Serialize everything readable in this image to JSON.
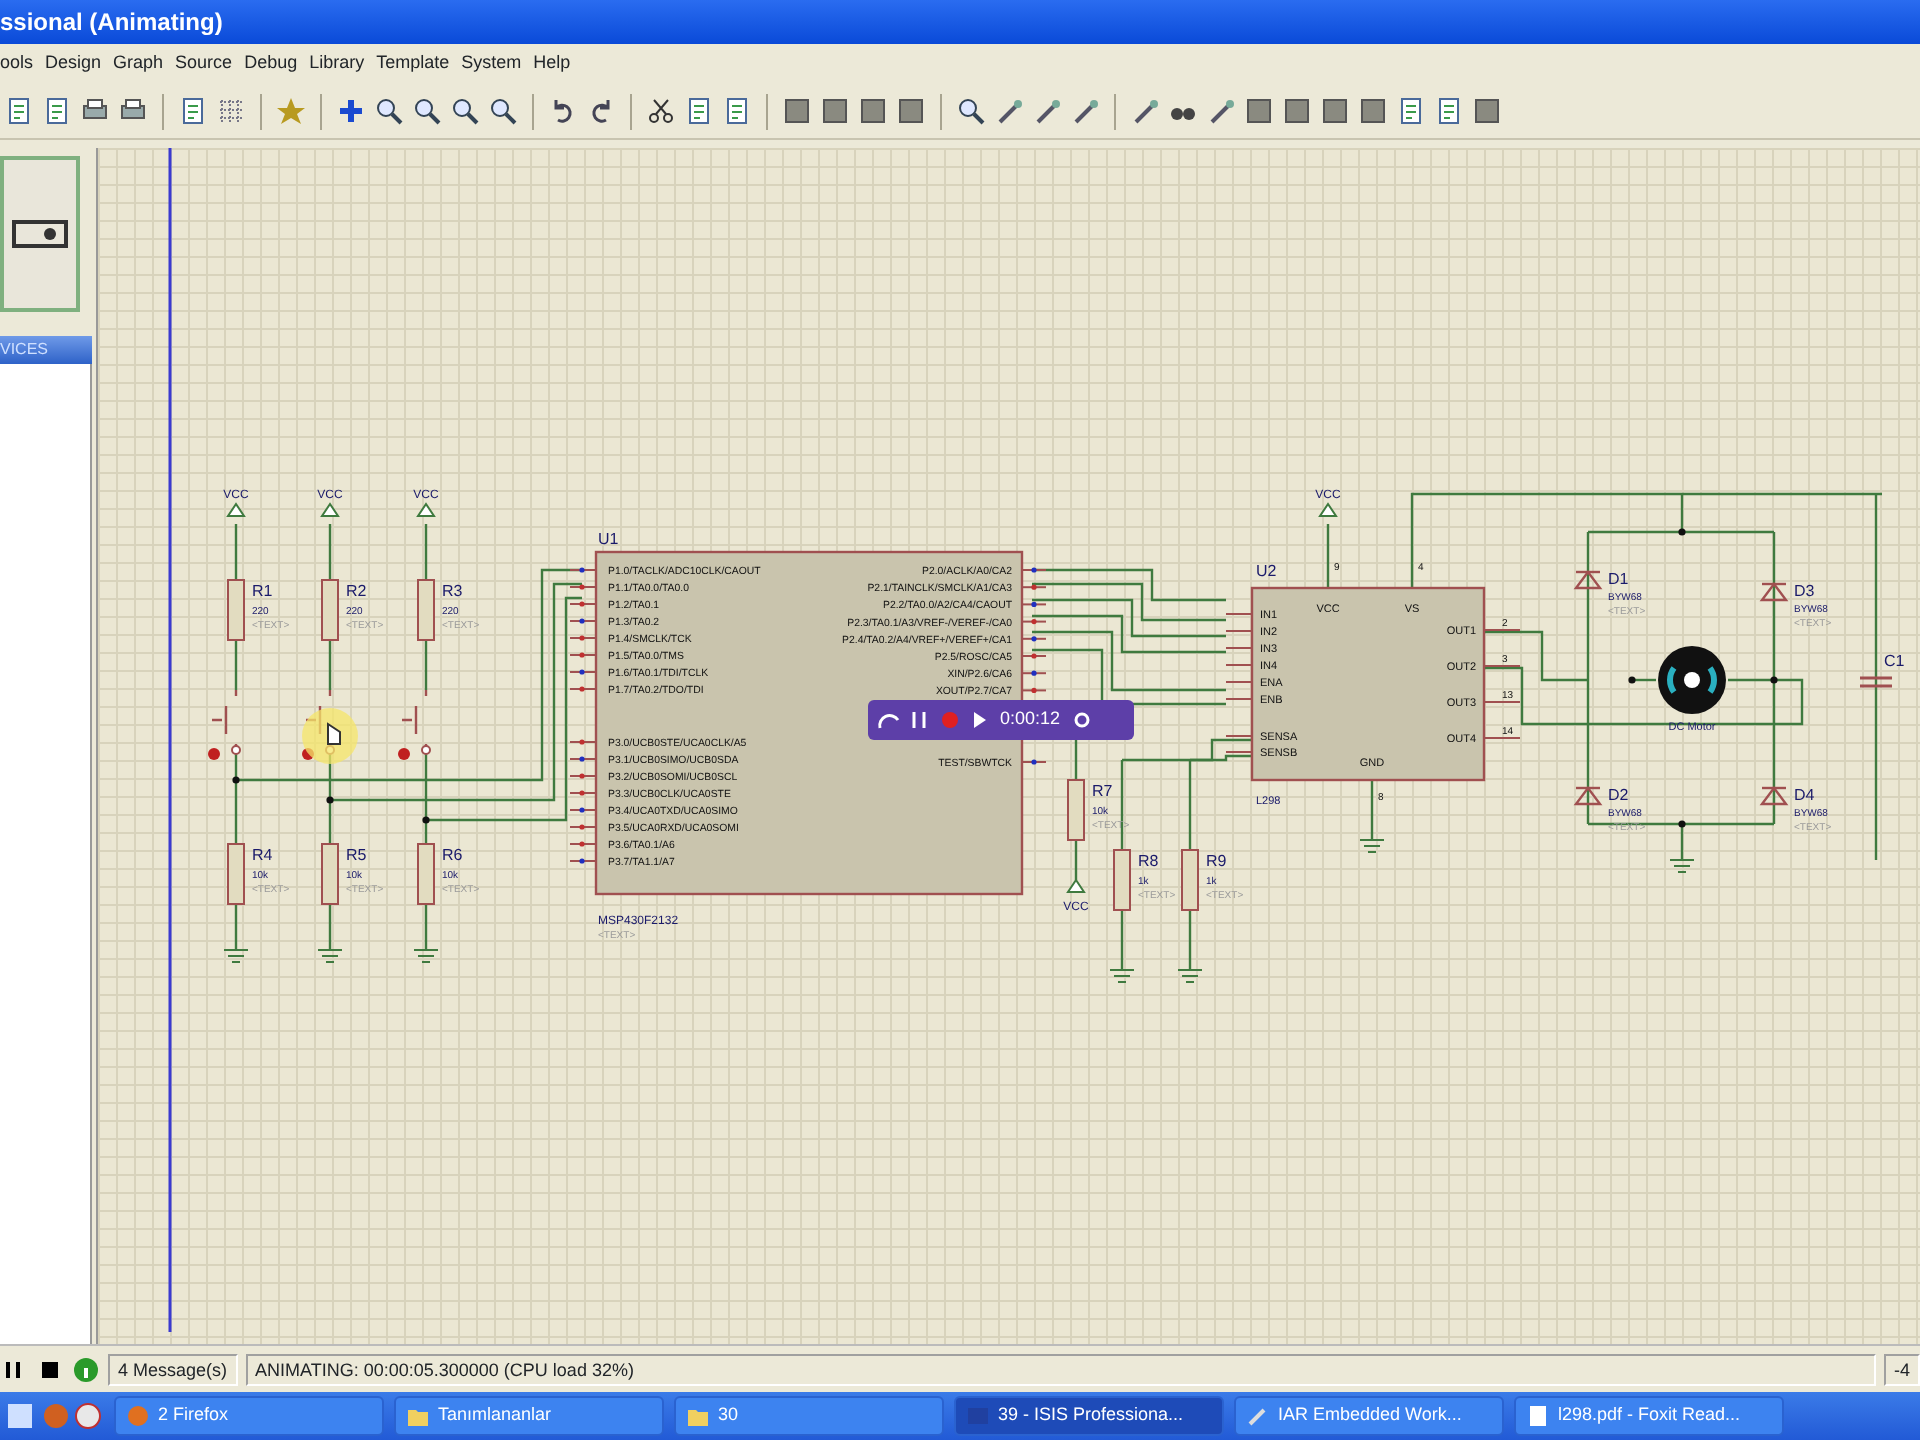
{
  "window": {
    "title": "ssional (Animating)"
  },
  "menu": [
    "ools",
    "Design",
    "Graph",
    "Source",
    "Debug",
    "Library",
    "Template",
    "System",
    "Help"
  ],
  "sidebar": {
    "header": "VICES"
  },
  "schematic": {
    "power": [
      {
        "kind": "vcc",
        "label": "VCC"
      },
      {
        "kind": "vcc",
        "label": "VCC"
      },
      {
        "kind": "vcc",
        "label": "VCC"
      },
      {
        "kind": "vcc",
        "label": "VCC"
      },
      {
        "kind": "vcc",
        "label": "VCC"
      }
    ],
    "resistors": [
      {
        "ref": "R1",
        "value": "220",
        "tag": "<TEXT>"
      },
      {
        "ref": "R2",
        "value": "220",
        "tag": "<TEXT>"
      },
      {
        "ref": "R3",
        "value": "220",
        "tag": "<TEXT>"
      },
      {
        "ref": "R4",
        "value": "10k",
        "tag": "<TEXT>"
      },
      {
        "ref": "R5",
        "value": "10k",
        "tag": "<TEXT>"
      },
      {
        "ref": "R6",
        "value": "10k",
        "tag": "<TEXT>"
      },
      {
        "ref": "R7",
        "value": "10k",
        "tag": "<TEXT>"
      },
      {
        "ref": "R8",
        "value": "1k",
        "tag": "<TEXT>"
      },
      {
        "ref": "R9",
        "value": "1k",
        "tag": "<TEXT>"
      }
    ],
    "u1": {
      "ref": "U1",
      "part": "MSP430F2132",
      "tag": "<TEXT>",
      "left_pins": [
        "P1.0/TACLK/ADC10CLK/CAOUT",
        "P1.1/TA0.0/TA0.0",
        "P1.2/TA0.1",
        "P1.3/TA0.2",
        "P1.4/SMCLK/TCK",
        "P1.5/TA0.0/TMS",
        "P1.6/TA0.1/TDI/TCLK",
        "P1.7/TA0.2/TDO/TDI",
        "P3.0/UCB0STE/UCA0CLK/A5",
        "P3.1/UCB0SIMO/UCB0SDA",
        "P3.2/UCB0SOMI/UCB0SCL",
        "P3.3/UCB0CLK/UCA0STE",
        "P3.4/UCA0TXD/UCA0SIMO",
        "P3.5/UCA0RXD/UCA0SOMI",
        "P3.6/TA0.1/A6",
        "P3.7/TA1.1/A7"
      ],
      "right_pins": [
        "P2.0/ACLK/A0/CA2",
        "P2.1/TAINCLK/SMCLK/A1/CA3",
        "P2.2/TA0.0/A2/CA4/CAOUT",
        "P2.3/TA0.1/A3/VREF-/VEREF-/CA0",
        "P2.4/TA0.2/A4/VREF+/VEREF+/CA1",
        "P2.5/ROSC/CA5",
        "XIN/P2.6/CA6",
        "XOUT/P2.7/CA7",
        "TEST/SBWTCK"
      ]
    },
    "u2": {
      "ref": "U2",
      "part": "L298",
      "left_pins": [
        "IN1",
        "IN2",
        "IN3",
        "IN4",
        "ENA",
        "ENB",
        "SENSA",
        "SENSB"
      ],
      "top_pins": [
        "VCC",
        "VS"
      ],
      "top_numbers": [
        "9",
        "4"
      ],
      "right_pins": [
        "OUT1",
        "OUT2",
        "OUT3",
        "OUT4"
      ],
      "right_numbers": [
        "2",
        "3",
        "13",
        "14"
      ],
      "bottom_pin": "GND",
      "bottom_number": "8"
    },
    "diodes": [
      {
        "ref": "D1",
        "part": "BYW68",
        "tag": "<TEXT>"
      },
      {
        "ref": "D3",
        "part": "BYW68",
        "tag": "<TEXT>"
      },
      {
        "ref": "D2",
        "part": "BYW68",
        "tag": "<TEXT>"
      },
      {
        "ref": "D4",
        "part": "BYW68",
        "tag": "<TEXT>"
      }
    ],
    "motor": {
      "label": "DC Motor"
    },
    "capacitor": {
      "ref": "C1"
    }
  },
  "recorder": {
    "time": "0:00:12"
  },
  "status": {
    "messages": "4 Message(s)",
    "animation": "ANIMATING: 00:00:05.300000 (CPU load 32%)",
    "edge": "-4"
  },
  "taskbar": [
    {
      "label": "2 Firefox",
      "selected": false
    },
    {
      "label": "Tanımlananlar",
      "selected": false
    },
    {
      "label": "30",
      "selected": false
    },
    {
      "label": "39 - ISIS Professiona...",
      "selected": true
    },
    {
      "label": "IAR Embedded Work...",
      "selected": false
    },
    {
      "label": "l298.pdf - Foxit Read...",
      "selected": false
    }
  ]
}
